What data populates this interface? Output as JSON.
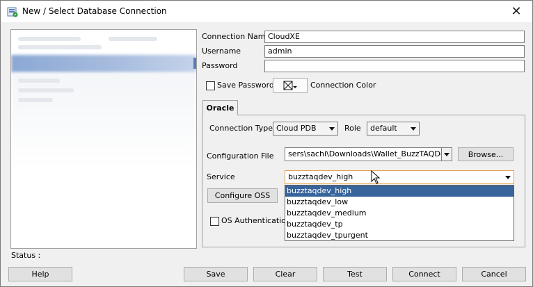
{
  "window": {
    "title": "New / Select Database Connection",
    "app_icon": "database-connection-icon",
    "close_glyph": "✕"
  },
  "form": {
    "connection_name_label": "Connection Name",
    "connection_name_value": "CloudXE",
    "username_label": "Username",
    "username_value": "admin",
    "password_label": "Password",
    "password_value": "",
    "save_password_label": "Save Password",
    "save_password_checked": false,
    "connection_color_label": "Connection Color"
  },
  "tabs": [
    {
      "label": "Oracle",
      "active": true
    }
  ],
  "oracle": {
    "connection_type_label": "Connection Type",
    "connection_type_value": "Cloud PDB",
    "role_label": "Role",
    "role_value": "default",
    "config_file_label": "Configuration File",
    "config_file_value": "sers\\sachi\\Downloads\\Wallet_BuzzTAQDev.zip",
    "browse_label": "Browse...",
    "service_label": "Service",
    "service_value": "buzztaqdev_high",
    "service_options": [
      "buzztaqdev_high",
      "buzztaqdev_low",
      "buzztaqdev_medium",
      "buzztaqdev_tp",
      "buzztaqdev_tpurgent"
    ],
    "configure_oss_label": "Configure OSS",
    "os_auth_label": "OS Authentication",
    "os_auth_checked": false
  },
  "status": {
    "label": "Status :"
  },
  "buttons": {
    "help": "Help",
    "save": "Save",
    "clear": "Clear",
    "test": "Test",
    "connect": "Connect",
    "cancel": "Cancel"
  },
  "colors": {
    "selection": "#38649c",
    "focus_border": "#e3a24a",
    "dialog_bg": "#f0f0f0"
  }
}
